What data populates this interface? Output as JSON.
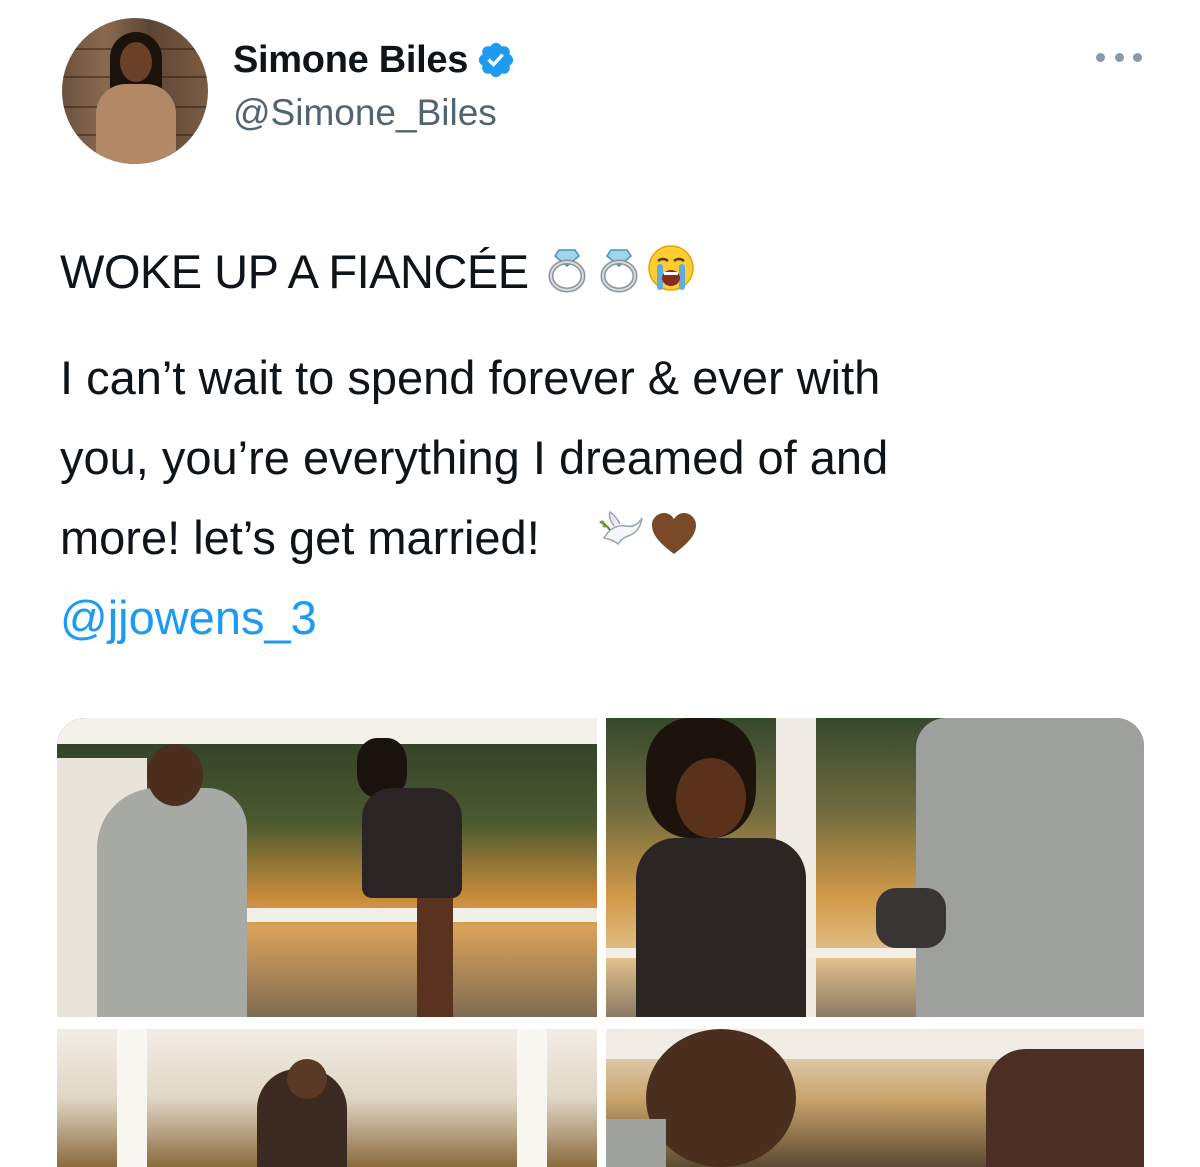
{
  "author": {
    "display_name": "Simone Biles",
    "handle": "@Simone_Biles",
    "verified": true,
    "avatar_icon": "profile-photo"
  },
  "tweet": {
    "headline": "WOKE UP A FIANCÉE",
    "headline_emojis": [
      "ring-icon",
      "ring-icon",
      "loudly-crying-face-icon"
    ],
    "body_lines": [
      "I can’t wait to spend forever & ever with",
      "you, you’re everything I dreamed of and",
      "more! let’s get married!"
    ],
    "body_emojis": [
      "dove-icon",
      "brown-heart-icon"
    ],
    "mention": "@jjowens_3"
  },
  "media": {
    "photos": [
      "proposal-photo-kneeling",
      "proposal-photo-ring",
      "proposal-photo-embrace",
      "proposal-photo-smile"
    ]
  },
  "colors": {
    "text": "#0f1419",
    "secondary_text": "#536471",
    "link": "#1d9bf0",
    "verified_badge": "#1d9bf0"
  }
}
